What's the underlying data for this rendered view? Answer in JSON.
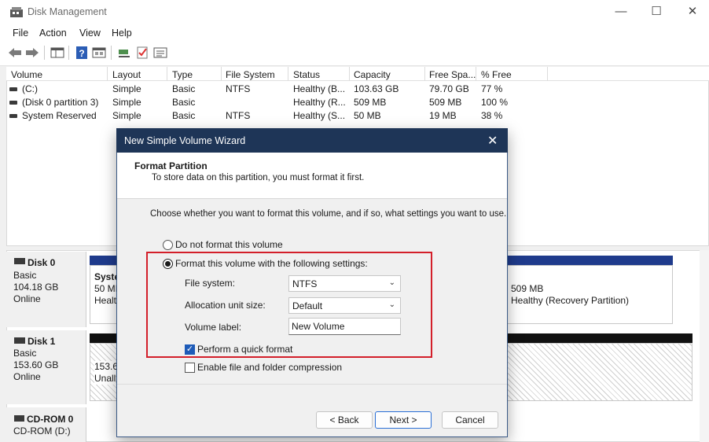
{
  "window": {
    "title": "Disk Management",
    "minimize": "—",
    "maximize": "☐",
    "close": "✕"
  },
  "menu": [
    "File",
    "Action",
    "View",
    "Help"
  ],
  "columns": [
    "Volume",
    "Layout",
    "Type",
    "File System",
    "Status",
    "Capacity",
    "Free Spa...",
    "% Free"
  ],
  "volumes": [
    {
      "volume": "(C:)",
      "layout": "Simple",
      "type": "Basic",
      "fs": "NTFS",
      "status": "Healthy (B...",
      "capacity": "103.63 GB",
      "free": "79.70 GB",
      "pct": "77 %"
    },
    {
      "volume": "(Disk 0 partition 3)",
      "layout": "Simple",
      "type": "Basic",
      "fs": "",
      "status": "Healthy (R...",
      "capacity": "509 MB",
      "free": "509 MB",
      "pct": "100 %"
    },
    {
      "volume": "System Reserved",
      "layout": "Simple",
      "type": "Basic",
      "fs": "NTFS",
      "status": "Healthy (S...",
      "capacity": "50 MB",
      "free": "19 MB",
      "pct": "38 %"
    }
  ],
  "disks": [
    {
      "name": "Disk 0",
      "type": "Basic",
      "size": "104.18 GB",
      "state": "Online",
      "part1_l1": "Syste",
      "part1_l2": "50 MI",
      "part1_l3": "Healt",
      "part3_size": "509 MB",
      "part3_status": "Healthy (Recovery Partition)"
    },
    {
      "name": "Disk 1",
      "type": "Basic",
      "size": "153.60 GB",
      "state": "Online",
      "part_l1": "153.6",
      "part_l2": "Unall"
    },
    {
      "name": "CD-ROM 0",
      "line2": "CD-ROM (D:)"
    }
  ],
  "dialog": {
    "title": "New Simple Volume Wizard",
    "close": "✕",
    "header_title": "Format Partition",
    "header_sub": "To store data on this partition, you must format it first.",
    "intro": "Choose whether you want to format this volume, and if so, what settings you want to use.",
    "opt_no_format": "Do not format this volume",
    "opt_format": "Format this volume with the following settings:",
    "fs_label": "File system:",
    "fs_value": "NTFS",
    "alloc_label": "Allocation unit size:",
    "alloc_value": "Default",
    "vol_label": "Volume label:",
    "vol_value": "New Volume",
    "quick_format": "Perform a quick format",
    "compression": "Enable file and folder compression",
    "back": "< Back",
    "next": "Next >",
    "cancel": "Cancel"
  },
  "colors": {
    "highlight": "#d31f2a",
    "titlebar": "#1e3557",
    "partition_bar": "#1f3b8c"
  }
}
